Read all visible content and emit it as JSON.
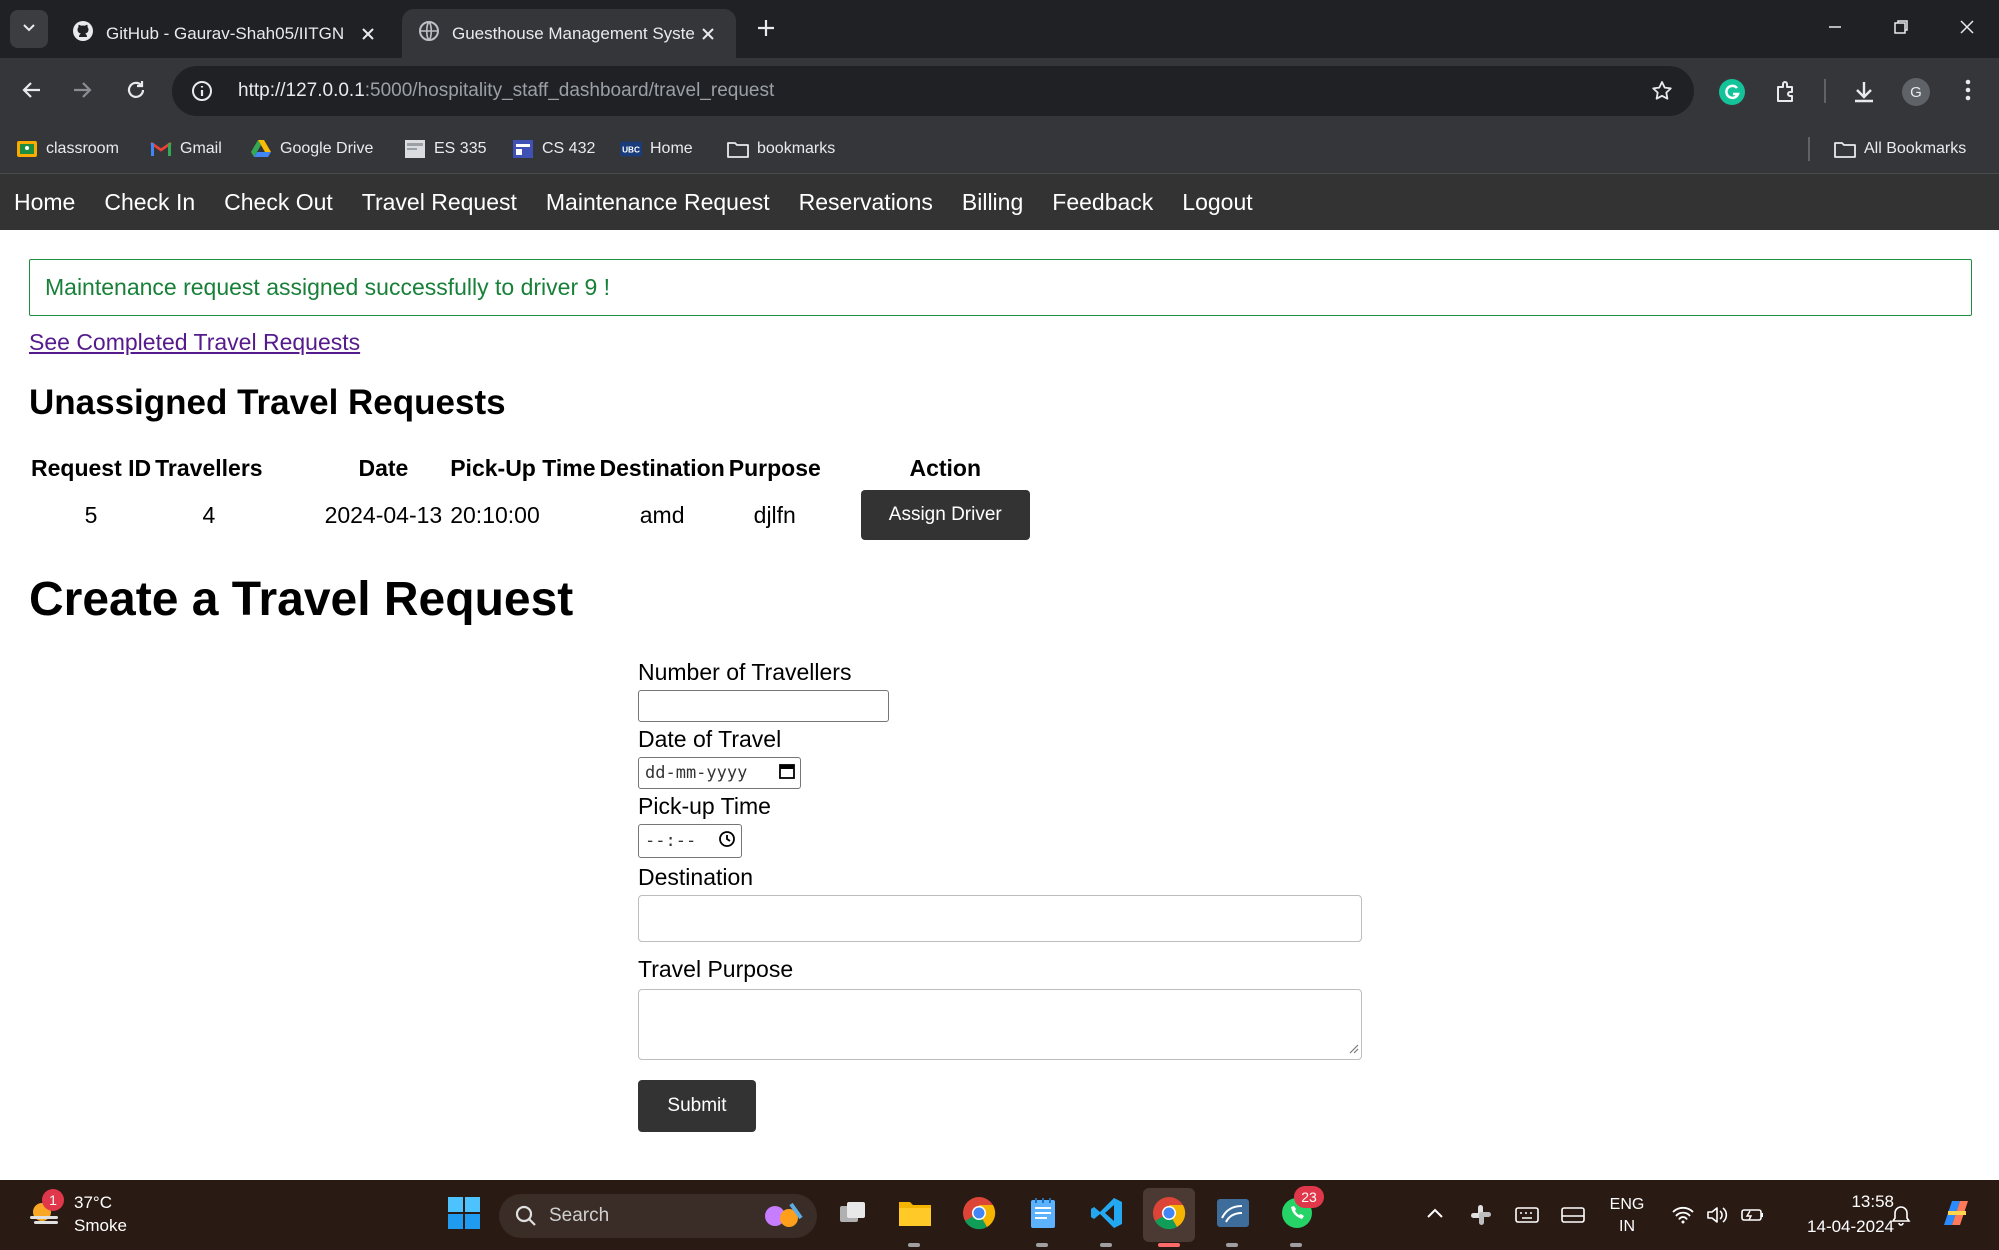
{
  "browser": {
    "tabs": [
      {
        "title": "GitHub - Gaurav-Shah05/IITGN",
        "active": false
      },
      {
        "title": "Guesthouse Management Syste",
        "active": true
      }
    ],
    "url_host": "http://127.0.0.1",
    "url_path": ":5000/hospitality_staff_dashboard/travel_request",
    "profile_initial": "G",
    "bookmarks": [
      "classroom",
      "Gmail",
      "Google Drive",
      "ES 335",
      "CS 432",
      "Home",
      "bookmarks"
    ],
    "all_bookmarks": "All Bookmarks"
  },
  "nav": {
    "items": [
      "Home",
      "Check In",
      "Check Out",
      "Travel Request",
      "Maintenance Request",
      "Reservations",
      "Billing",
      "Feedback",
      "Logout"
    ]
  },
  "alert": {
    "message": "Maintenance request assigned successfully to driver 9 !",
    "color": "#188038"
  },
  "completed_link": "See Completed Travel Requests",
  "unassigned": {
    "heading": "Unassigned Travel Requests",
    "columns": [
      "Request ID",
      "Travellers",
      "Date",
      "Pick-Up Time",
      "Destination",
      "Purpose",
      "Action"
    ],
    "rows": [
      {
        "id": "5",
        "travellers": "4",
        "date": "2024-04-13",
        "time": "20:10:00",
        "destination": "amd",
        "purpose": "djlfn",
        "action": "Assign Driver"
      }
    ]
  },
  "create_form": {
    "heading": "Create a Travel Request",
    "travellers_label": "Number of Travellers",
    "date_label": "Date of Travel",
    "date_placeholder": "dd-mm-yyyy",
    "time_label": "Pick-up Time",
    "time_placeholder": "--:--",
    "destination_label": "Destination",
    "purpose_label": "Travel Purpose",
    "submit": "Submit"
  },
  "taskbar": {
    "temperature": "37°C",
    "weather": "Smoke",
    "weather_badge": "1",
    "search": "Search",
    "whatsapp_badge": "23",
    "language": "ENG",
    "region": "IN",
    "time": "13:58",
    "date": "14-04-2024"
  }
}
